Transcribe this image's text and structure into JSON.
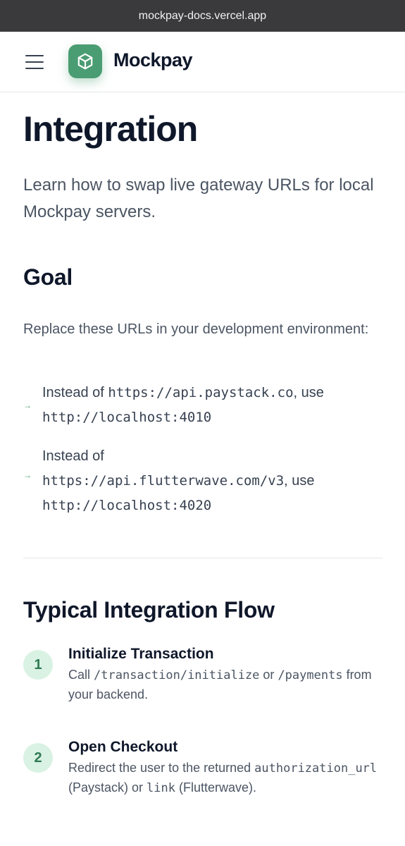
{
  "browser": {
    "url": "mockpay-docs.vercel.app"
  },
  "header": {
    "brand": "Mockpay",
    "menu_icon": "hamburger-menu-icon",
    "logo_icon": "cube-icon",
    "logo_color": "#4a9d72"
  },
  "page": {
    "title": "Integration",
    "lead": "Learn how to swap live gateway URLs for local Mockpay servers."
  },
  "goal": {
    "heading": "Goal",
    "description": "Replace these URLs in your development environment:",
    "items": [
      {
        "prefix": "Instead of ",
        "from": "https://api.paystack.co",
        "mid": ", use ",
        "to": "http://localhost:4010"
      },
      {
        "prefix": "Instead of ",
        "from": "https://api.flutterwave.com/v3",
        "mid": ", use ",
        "to": "http://localhost:4020"
      }
    ],
    "arrow_icon": "arrow-right-icon"
  },
  "flow": {
    "heading": "Typical Integration Flow",
    "steps": [
      {
        "number": "1",
        "title": "Initialize Transaction",
        "text_1": "Call ",
        "code_1": "/transaction/initialize",
        "text_2": " or ",
        "code_2": "/payments",
        "text_3": " from your backend."
      },
      {
        "number": "2",
        "title": "Open Checkout",
        "text_1": "Redirect the user to the returned ",
        "code_1": "authorization_url",
        "text_2": " (Paystack) or ",
        "code_2": "link",
        "text_3": " (Flutterwave)."
      }
    ]
  },
  "colors": {
    "accent": "#4a9d72",
    "step_badge_bg": "#d9f2e3",
    "heading": "#0f172a",
    "body": "#4b5563"
  }
}
